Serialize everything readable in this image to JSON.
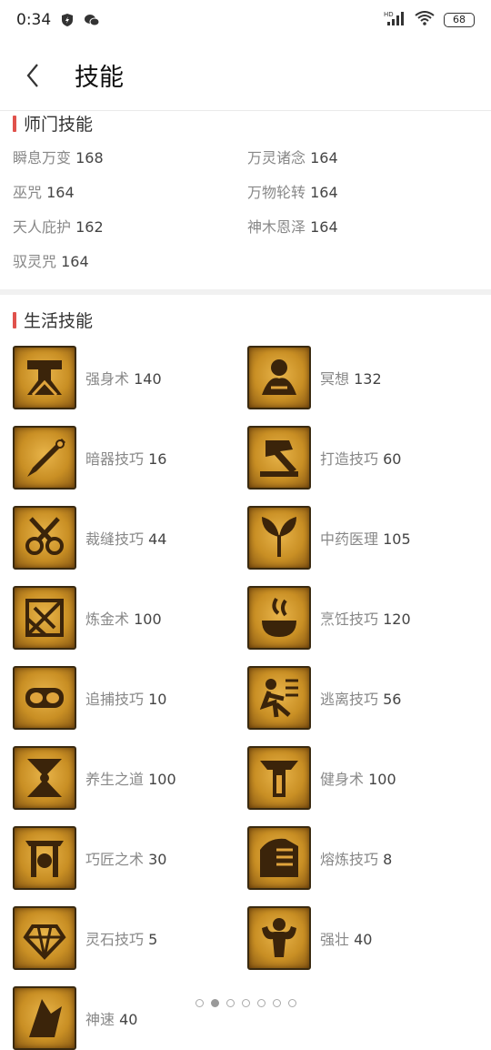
{
  "status": {
    "time": "0:34",
    "battery": "68",
    "network": "HD"
  },
  "header": {
    "title": "技能"
  },
  "school_skills": {
    "title": "师门技能",
    "items": [
      {
        "name": "瞬息万变",
        "level": "168"
      },
      {
        "name": "万灵诸念",
        "level": "164"
      },
      {
        "name": "巫咒",
        "level": "164"
      },
      {
        "name": "万物轮转",
        "level": "164"
      },
      {
        "name": "天人庇护",
        "level": "162"
      },
      {
        "name": "神木恩泽",
        "level": "164"
      },
      {
        "name": "驭灵咒",
        "level": "164"
      }
    ]
  },
  "life_skills": {
    "title": "生活技能",
    "items": [
      {
        "name": "强身术",
        "level": "140",
        "icon": "fortify-icon"
      },
      {
        "name": "冥想",
        "level": "132",
        "icon": "meditate-icon"
      },
      {
        "name": "暗器技巧",
        "level": "16",
        "icon": "dart-icon"
      },
      {
        "name": "打造技巧",
        "level": "60",
        "icon": "forge-icon"
      },
      {
        "name": "裁缝技巧",
        "level": "44",
        "icon": "scissors-icon"
      },
      {
        "name": "中药医理",
        "level": "105",
        "icon": "herb-icon"
      },
      {
        "name": "炼金术",
        "level": "100",
        "icon": "alchemy-icon"
      },
      {
        "name": "烹饪技巧",
        "level": "120",
        "icon": "cooking-icon"
      },
      {
        "name": "追捕技巧",
        "level": "10",
        "icon": "pursuit-icon"
      },
      {
        "name": "逃离技巧",
        "level": "56",
        "icon": "escape-icon"
      },
      {
        "name": "养生之道",
        "level": "100",
        "icon": "health-icon"
      },
      {
        "name": "健身术",
        "level": "100",
        "icon": "fitness-icon"
      },
      {
        "name": "巧匠之术",
        "level": "30",
        "icon": "craftsman-icon"
      },
      {
        "name": "熔炼技巧",
        "level": "8",
        "icon": "smelting-icon"
      },
      {
        "name": "灵石技巧",
        "level": "5",
        "icon": "gem-icon"
      },
      {
        "name": "强壮",
        "level": "40",
        "icon": "strong-icon"
      },
      {
        "name": "神速",
        "level": "40",
        "icon": "speed-icon"
      }
    ]
  },
  "pager": {
    "count": 7,
    "active": 1
  }
}
